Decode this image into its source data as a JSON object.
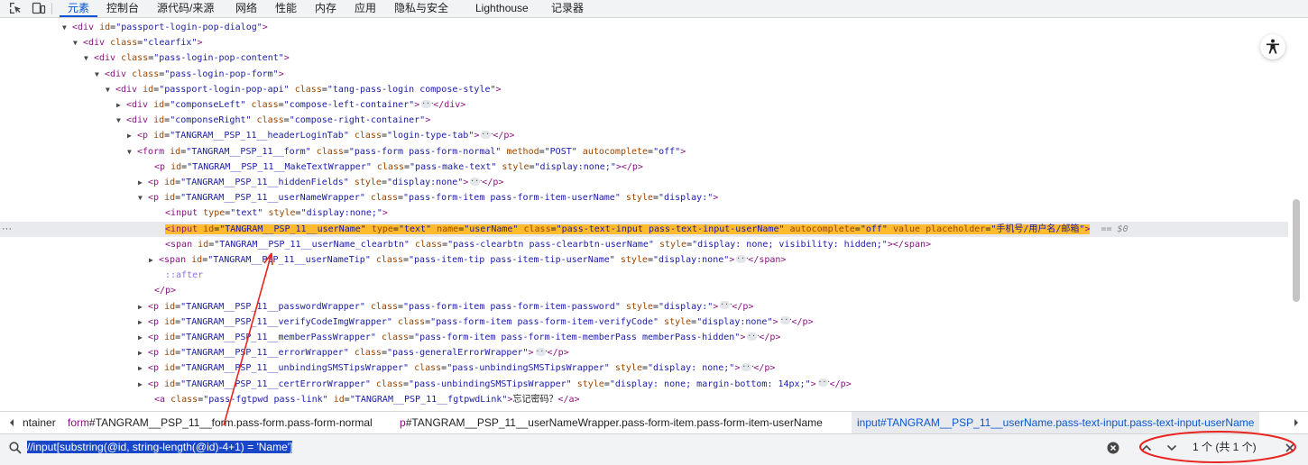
{
  "toolbar": {
    "inspect_icon": "inspect-element-icon",
    "device_icon": "device-toggle-icon",
    "tabs": [
      "元素",
      "控制台",
      "源代码/来源",
      "网络",
      "性能",
      "内存",
      "应用",
      "隐私与安全",
      "Lighthouse",
      "记录器"
    ],
    "active_tab": "元素"
  },
  "tree": {
    "selected_suffix": "== $0",
    "lines": [
      {
        "open": "<div",
        "attrs": [
          [
            "id",
            "passport-login-pop-dialog"
          ]
        ],
        "close": ">"
      },
      {
        "open": "<div",
        "attrs": [
          [
            "class",
            "clearfix"
          ]
        ],
        "close": ">"
      },
      {
        "open": "<div",
        "attrs": [
          [
            "class",
            "pass-login-pop-content"
          ]
        ],
        "close": ">"
      },
      {
        "open": "<div",
        "attrs": [
          [
            "class",
            "pass-login-pop-form"
          ]
        ],
        "close": ">"
      },
      {
        "open": "<div",
        "attrs": [
          [
            "id",
            "passport-login-pop-api"
          ],
          [
            "class",
            "tang-pass-login compose-style"
          ]
        ],
        "close": ">"
      },
      {
        "open": "<div",
        "attrs": [
          [
            "id",
            "componseLeft"
          ],
          [
            "class",
            "compose-left-container"
          ]
        ],
        "close": ">",
        "end": "</div>"
      },
      {
        "open": "<div",
        "attrs": [
          [
            "id",
            "componseRight"
          ],
          [
            "class",
            "compose-right-container"
          ]
        ],
        "close": ">"
      },
      {
        "open": "<p",
        "attrs": [
          [
            "id",
            "TANGRAM__PSP_11__headerLoginTab"
          ],
          [
            "class",
            "login-type-tab"
          ]
        ],
        "close": ">",
        "end": "</p>"
      },
      {
        "open": "<form",
        "attrs": [
          [
            "id",
            "TANGRAM__PSP_11__form"
          ],
          [
            "class",
            "pass-form pass-form-normal"
          ],
          [
            "method",
            "POST"
          ],
          [
            "autocomplete",
            "off"
          ]
        ],
        "close": ">"
      },
      {
        "open": "<p",
        "attrs": [
          [
            "id",
            "TANGRAM__PSP_11__MakeTextWrapper"
          ],
          [
            "class",
            "pass-make-text"
          ],
          [
            "style",
            "display:none;"
          ]
        ],
        "close": ">",
        "text": "</p>"
      },
      {
        "open": "<p",
        "attrs": [
          [
            "id",
            "TANGRAM__PSP_11__hiddenFields"
          ],
          [
            "style",
            "display:none"
          ]
        ],
        "close": ">",
        "end": "</p>"
      },
      {
        "open": "<p",
        "attrs": [
          [
            "id",
            "TANGRAM__PSP_11__userNameWrapper"
          ],
          [
            "class",
            "pass-form-item pass-form-item-userName"
          ],
          [
            "style",
            "display:"
          ]
        ],
        "close": ">"
      },
      {
        "open": "<input",
        "attrs": [
          [
            "type",
            "text"
          ],
          [
            "style",
            "display:none;"
          ]
        ],
        "close": ">"
      },
      {
        "open": "<input",
        "attrs": [
          [
            "id",
            "TANGRAM__PSP_11__userName"
          ],
          [
            "type",
            "text"
          ],
          [
            "name",
            "userName"
          ],
          [
            "class",
            "pass-text-input pass-text-input-userName"
          ],
          [
            "autocomplete",
            "off"
          ],
          [
            "value",
            null
          ],
          [
            "placeholder",
            "手机号/用户名/邮箱"
          ]
        ],
        "close": ">"
      },
      {
        "open": "<span",
        "attrs": [
          [
            "id",
            "TANGRAM__PSP_11__userName_clearbtn"
          ],
          [
            "class",
            "pass-clearbtn pass-clearbtn-userName"
          ],
          [
            "style",
            "display: none; visibility: hidden;"
          ]
        ],
        "close": ">",
        "text": "</span>"
      },
      {
        "open": "<span",
        "attrs": [
          [
            "id",
            "TANGRAM__PSP_11__userNameTip"
          ],
          [
            "class",
            "pass-item-tip pass-item-tip-userName"
          ],
          [
            "style",
            "display:none"
          ]
        ],
        "close": ">",
        "end": "</span>"
      },
      {
        "pseudo": "::after"
      },
      {
        "plain": "</p>"
      },
      {
        "open": "<p",
        "attrs": [
          [
            "id",
            "TANGRAM__PSP_11__passwordWrapper"
          ],
          [
            "class",
            "pass-form-item pass-form-item-password"
          ],
          [
            "style",
            "display:"
          ]
        ],
        "close": ">",
        "end": "</p>"
      },
      {
        "open": "<p",
        "attrs": [
          [
            "id",
            "TANGRAM__PSP_11__verifyCodeImgWrapper"
          ],
          [
            "class",
            "pass-form-item pass-form-item-verifyCode"
          ],
          [
            "style",
            "display:none"
          ]
        ],
        "close": ">",
        "end": "</p>"
      },
      {
        "open": "<p",
        "attrs": [
          [
            "id",
            "TANGRAM__PSP_11__memberPassWrapper"
          ],
          [
            "class",
            "pass-form-item pass-form-item-memberPass memberPass-hidden"
          ]
        ],
        "close": ">",
        "end": "</p>"
      },
      {
        "open": "<p",
        "attrs": [
          [
            "id",
            "TANGRAM__PSP_11__errorWrapper"
          ],
          [
            "class",
            "pass-generalErrorWrapper"
          ]
        ],
        "close": ">",
        "end": "</p>"
      },
      {
        "open": "<p",
        "attrs": [
          [
            "id",
            "TANGRAM__PSP_11__unbindingSMSTipsWrapper"
          ],
          [
            "class",
            "pass-unbindingSMSTipsWrapper"
          ],
          [
            "style",
            "display: none;"
          ]
        ],
        "close": ">",
        "end": "</p>"
      },
      {
        "open": "<p",
        "attrs": [
          [
            "id",
            "TANGRAM__PSP_11__certErrorWrapper"
          ],
          [
            "class",
            "pass-unbindingSMSTipsWrapper"
          ],
          [
            "style",
            "display: none; margin-bottom: 14px;"
          ]
        ],
        "close": ">",
        "end": "</p>"
      },
      {
        "open": "<a",
        "attrs": [
          [
            "class",
            "pass-fgtpwd pass-link"
          ],
          [
            "id",
            "TANGRAM__PSP_11__fgtpwdLink"
          ]
        ],
        "close": ">",
        "text": "忘记密码？</a>"
      }
    ]
  },
  "breadcrumb": [
    {
      "kw": "",
      "rest": "ntainer"
    },
    {
      "kw": "form",
      "rest": "#TANGRAM__PSP_11__form.pass-form.pass-form-normal"
    },
    {
      "kw": "p",
      "rest": "#TANGRAM__PSP_11__userNameWrapper.pass-form-item.pass-form-item-userName"
    },
    {
      "kw": "input",
      "rest": "#TANGRAM__PSP_11__userName.pass-text-input.pass-text-input-userName"
    }
  ],
  "search": {
    "query": "//input[substring(@id, string-length(@id)-4+1) = 'Name']",
    "match_count": "1 个 (共 1 个)"
  },
  "colors": {
    "accent": "#0b57d0",
    "highlight": "#ffbb2e",
    "annotation": "#e8251f"
  }
}
